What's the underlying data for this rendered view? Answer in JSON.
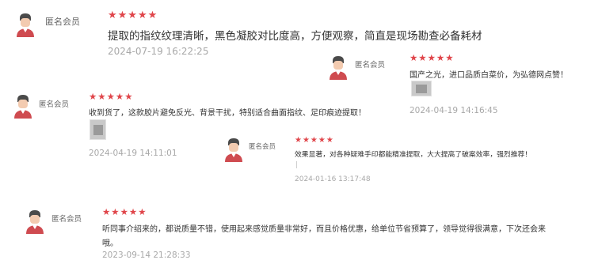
{
  "reviews": [
    {
      "user": "匿名会员",
      "stars": "★★★★★",
      "text": "提取的指纹纹理清晰，黑色凝胶对比度高，方便观察，简直是现场勘查必备耗材",
      "date": "2024-07-19 16:22:25"
    },
    {
      "user": "匿名会员",
      "stars": "★★★★★",
      "text": "国产之光，进口品质白菜价，为弘德网点赞！",
      "date": "2024-04-19 14:16:45"
    },
    {
      "user": "匿名会员",
      "stars": "★★★★★",
      "text": "收到货了，这款胶片避免反光、背景干扰，特别适合曲面指纹、足印痕迹提取！",
      "date": "2024-04-19 14:11:01"
    },
    {
      "user": "匿名会员",
      "stars": "★★★★★",
      "text": "效果显著，对各种疑难手印都能精准提取，大大提高了破案效率，强烈推荐！",
      "date": "2024-01-16 13:17:48"
    },
    {
      "user": "匿名会员",
      "stars": "★★★★★",
      "text_line1": "听同事介绍来的，都说质量不错，使用起来感觉质量非常好，而且价格优惠，给单位节省预算了，领导觉得很满意，下次还会来",
      "text_line2": "哦。",
      "date": "2023-09-14 21:28:33"
    }
  ]
}
